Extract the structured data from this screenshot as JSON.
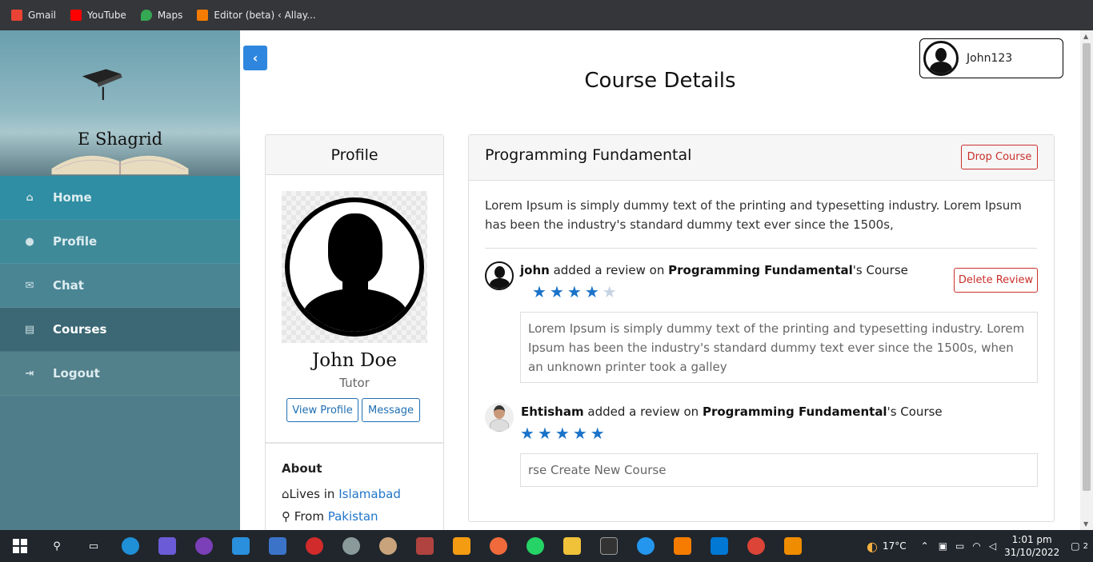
{
  "bookmarks": [
    {
      "label": "Gmail",
      "icon": "gmail-icon",
      "color": "#ea4335"
    },
    {
      "label": "YouTube",
      "icon": "youtube-icon",
      "color": "#ff0000"
    },
    {
      "label": "Maps",
      "icon": "maps-icon",
      "color": "#34a853"
    },
    {
      "label": "Editor (beta) ‹ Allay...",
      "icon": "editor-icon",
      "color": "#f57c00"
    }
  ],
  "sidebar": {
    "logo_title": "E Shagrid",
    "items": [
      {
        "label": "Home",
        "icon": "home-icon",
        "glyph": "⌂"
      },
      {
        "label": "Profile",
        "icon": "user-icon",
        "glyph": "●"
      },
      {
        "label": "Chat",
        "icon": "chat-icon",
        "glyph": "✉"
      },
      {
        "label": "Courses",
        "icon": "book-icon",
        "glyph": "▤",
        "active": true
      },
      {
        "label": "Logout",
        "icon": "logout-icon",
        "glyph": "⇥"
      }
    ]
  },
  "header": {
    "back_glyph": "‹",
    "username": "John123",
    "page_title": "Course Details"
  },
  "profile": {
    "card_title": "Profile",
    "name": "John Doe",
    "role": "Tutor",
    "view_profile": "View Profile",
    "message": "Message",
    "about_title": "About",
    "lives_prefix": "Lives in",
    "lives_city": "Islamabad",
    "from_prefix": "From",
    "from_country": "Pakistan"
  },
  "course": {
    "title": "Programming Fundamental",
    "drop_label": "Drop Course",
    "description": "Lorem Ipsum is simply dummy text of the printing and typesetting industry. Lorem Ipsum has been the industry's standard dummy text ever since the 1500s,",
    "reviews": [
      {
        "user": "john",
        "action": "added a review on",
        "course": "Programming Fundamental",
        "suffix": "'s Course",
        "rating": 4,
        "max_rating": 5,
        "text": "Lorem Ipsum is simply dummy text of the printing and typesetting industry. Lorem Ipsum has been the industry's standard dummy text ever since the 1500s, when an unknown printer took a galley",
        "delete_label": "Delete Review"
      },
      {
        "user": "Ehtisham",
        "action": "added a review on",
        "course": "Programming Fundamental",
        "suffix": "'s Course",
        "rating": 5,
        "max_rating": 5,
        "text": "rse Create New Course"
      }
    ]
  },
  "taskbar": {
    "weather": "17°C",
    "time": "1:01 pm",
    "date": "31/10/2022",
    "notifications": "2"
  },
  "colors": {
    "accent": "#2f86de",
    "danger": "#c9302c",
    "link": "#2276c9",
    "star": "#1a73c9",
    "sidebar": "#4f7e8a"
  }
}
